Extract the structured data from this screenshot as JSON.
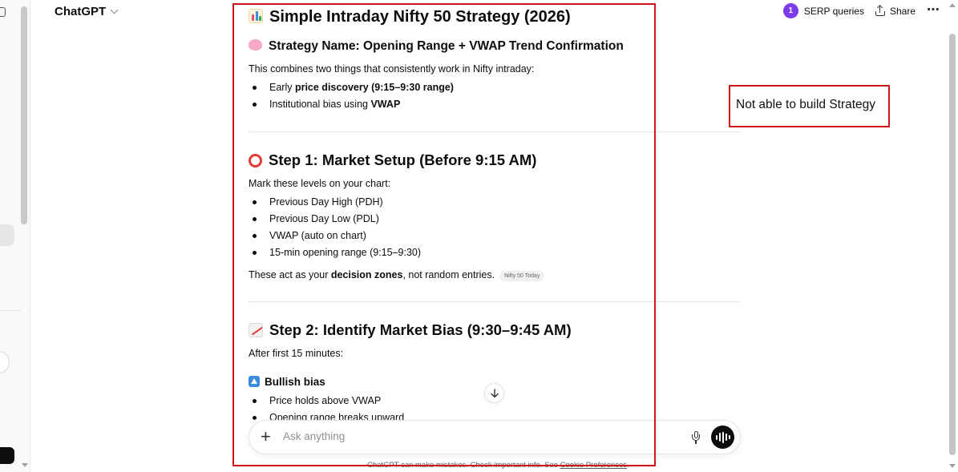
{
  "header": {
    "model_name": "ChatGPT",
    "project_badge": "1",
    "project_name": "SERP queries",
    "share_label": "Share",
    "more_label": "⋯"
  },
  "article": {
    "title": "Simple Intraday Nifty 50 Strategy (2026)",
    "strategy_heading": "Strategy Name: Opening Range + VWAP Trend Confirmation",
    "intro": "This combines two things that consistently work in Nifty intraday:",
    "intro_items": [
      {
        "pre": "Early ",
        "bold": "price discovery (9:15–9:30 range)"
      },
      {
        "pre": "Institutional bias using ",
        "bold": "VWAP"
      }
    ],
    "step1_heading": "Step 1: Market Setup (Before 9:15 AM)",
    "step1_intro": "Mark these levels on your chart:",
    "step1_items": [
      "Previous Day High (PDH)",
      "Previous Day Low (PDL)",
      "VWAP (auto on chart)",
      "15-min opening range (9:15–9:30)"
    ],
    "step1_note_pre": "These act as your ",
    "step1_note_bold": "decision zones",
    "step1_note_post": ", not random entries.",
    "step1_citation": "Nifty 50 Today",
    "step2_heading": "Step 2: Identify Market Bias (9:30–9:45 AM)",
    "step2_intro": "After first 15 minutes:",
    "bullish_heading": "Bullish bias",
    "bullish_items": [
      "Price holds above VWAP",
      "Opening range breaks upward"
    ]
  },
  "composer": {
    "placeholder": "Ask anything"
  },
  "footer": {
    "disclaimer": "ChatGPT can make mistakes. Check important info. See ",
    "link": "Cookie Preferences",
    "end": "."
  },
  "annotation": {
    "note": "Not able to build Strategy",
    "color": "#d0141c"
  },
  "colors": {
    "badge": "#7c3aed",
    "send_button": "#0d0d0d"
  }
}
